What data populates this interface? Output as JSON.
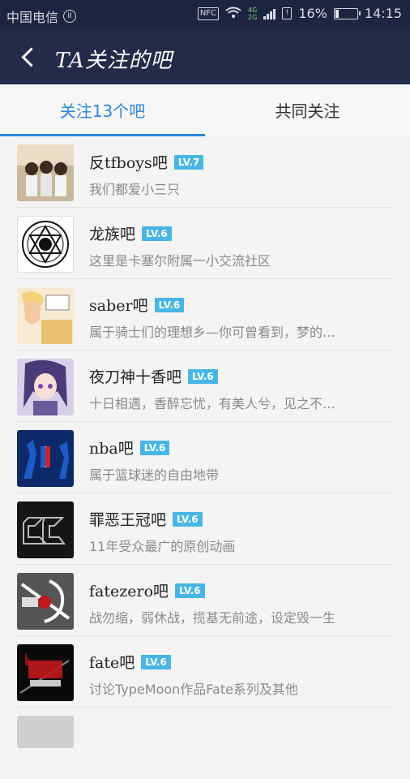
{
  "status_bar": {
    "carrier": "中国电信",
    "pause_glyph": "II",
    "nfc": "NFC",
    "net_4g": "4G",
    "net_2g": "2G",
    "battery_percent": "16%",
    "battery_level": 0.16,
    "time": "14:15"
  },
  "header": {
    "title": "TA关注的吧"
  },
  "tabs": [
    {
      "label": "关注13个吧",
      "active": true
    },
    {
      "label": "共同关注",
      "active": false
    }
  ],
  "forums": [
    {
      "name": "反tfboys吧",
      "level": "LV.7",
      "desc": "我们都爱小三只",
      "avatar_bg": "#c9b89a"
    },
    {
      "name": "龙族吧",
      "level": "LV.6",
      "desc": "这里是卡塞尔附属一小交流社区",
      "avatar_bg": "#ffffff"
    },
    {
      "name": "saber吧",
      "level": "LV.6",
      "desc": "属于骑士们的理想乡—你可曾看到，梦的…",
      "avatar_bg": "#f4e4c8"
    },
    {
      "name": "夜刀神十香吧",
      "level": "LV.6",
      "desc": "十日相遇，香醉忘忧，有美人兮，见之不…",
      "avatar_bg": "#8a7aa8"
    },
    {
      "name": "nba吧",
      "level": "LV.6",
      "desc": "属于篮球迷的自由地带",
      "avatar_bg": "#0c2a6a"
    },
    {
      "name": "罪恶王冠吧",
      "level": "LV.6",
      "desc": "11年受众最广的原创动画",
      "avatar_bg": "#1a1a1a"
    },
    {
      "name": "fatezero吧",
      "level": "LV.6",
      "desc": "战勿缩，弱休战，揽基无前途，设定毁一生",
      "avatar_bg": "#6a6a6a"
    },
    {
      "name": "fate吧",
      "level": "LV.6",
      "desc": "讨论TypeMoon作品Fate系列及其他",
      "avatar_bg": "#111111"
    }
  ]
}
